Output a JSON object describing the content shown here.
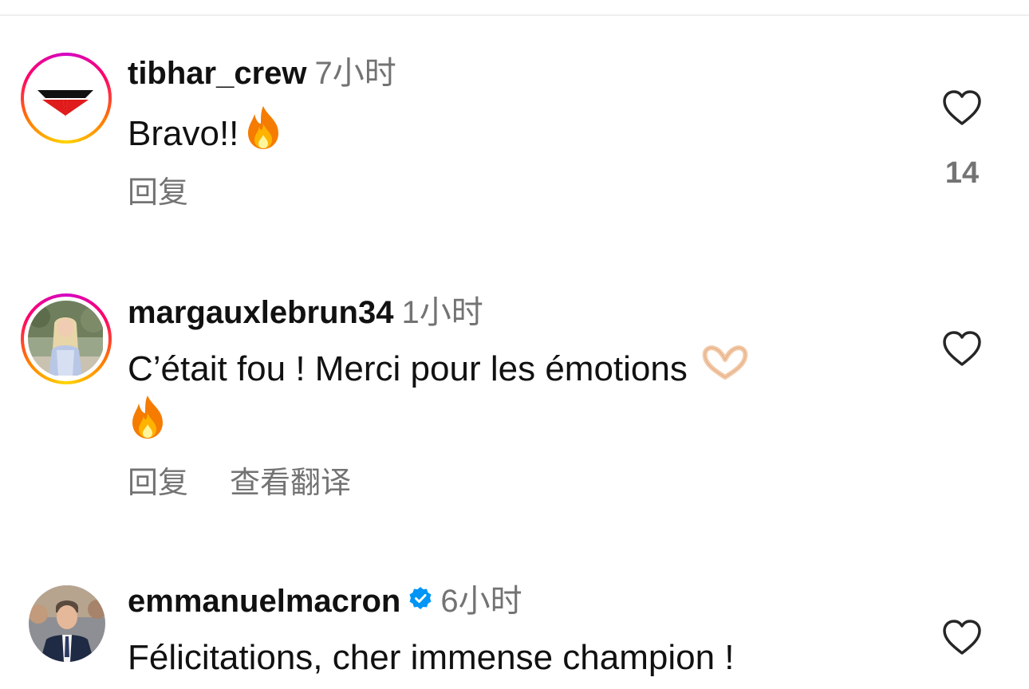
{
  "comments": [
    {
      "username": "tibhar_crew",
      "time": "7小时",
      "text": "Bravo!!",
      "actions": [
        "回复"
      ],
      "likes": "14",
      "avatar_icon": "tibhar-logo-icon"
    },
    {
      "username": "margauxlebrun34",
      "time": "1小时",
      "text": "C’était fou ! Merci pour les émotions",
      "actions": [
        "回复",
        "查看翻译"
      ],
      "likes": "",
      "avatar_icon": "user-photo"
    },
    {
      "username": "emmanuelmacron",
      "time": "6小时",
      "text": "Félicitations, cher immense champion !",
      "actions": [],
      "likes": "",
      "verified": true,
      "avatar_icon": "user-photo"
    }
  ],
  "icons": {
    "heart": "heart-outline-icon",
    "fire": "fire-emoji",
    "heart_hands": "heart-hands-emoji",
    "verified": "verified-badge-icon"
  },
  "colors": {
    "text_primary": "#111111",
    "text_secondary": "#737373",
    "verified_blue": "#0095f6",
    "story_ring_start": "#d300c5",
    "story_ring_end": "#ffd600"
  }
}
